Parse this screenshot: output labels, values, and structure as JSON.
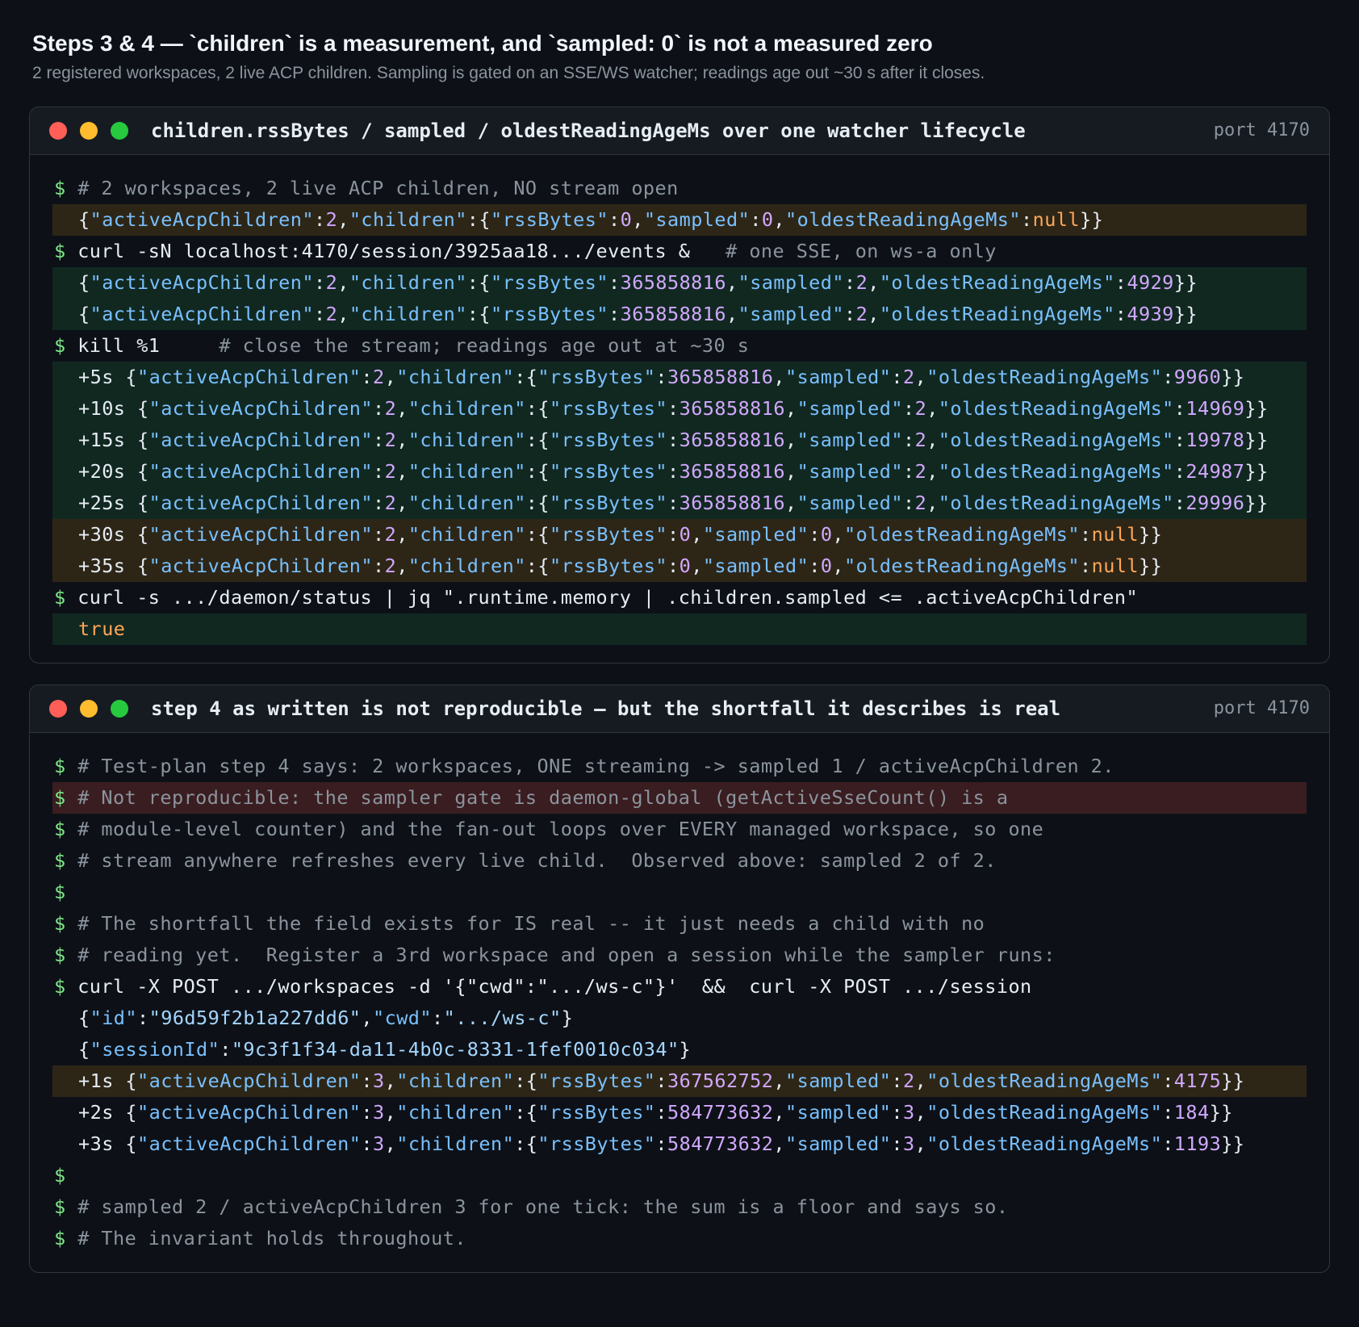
{
  "page": {
    "title": "Steps 3 & 4 — `children` is a measurement, and `sampled: 0` is not a measured zero",
    "subtitle": "2 registered workspaces, 2 live ACP children. Sampling is gated on an SSE/WS watcher; readings age out ~30 s after it closes."
  },
  "terminals": [
    {
      "title": "children.rssBytes / sampled / oldestReadingAgeMs over one watcher lifecycle",
      "port": "port 4170",
      "lines": [
        {
          "kind": "cmd",
          "comment": "# 2 workspaces, 2 live ACP children, NO stream open"
        },
        {
          "kind": "status",
          "hl": "amber",
          "prefix": "",
          "active": "2",
          "rss": "0",
          "sampled": "0",
          "age": "null"
        },
        {
          "kind": "cmd",
          "cmd": "curl -sN localhost:4170/session/3925aa18.../events & ",
          "comment": "  # one SSE, on ws-a only"
        },
        {
          "kind": "status",
          "hl": "green",
          "prefix": "",
          "active": "2",
          "rss": "365858816",
          "sampled": "2",
          "age": "4929"
        },
        {
          "kind": "status",
          "hl": "green",
          "prefix": "",
          "active": "2",
          "rss": "365858816",
          "sampled": "2",
          "age": "4939"
        },
        {
          "kind": "cmd",
          "cmd": "kill %1 ",
          "comment": "    # close the stream; readings age out at ~30 s"
        },
        {
          "kind": "status",
          "hl": "green",
          "prefix": "+5s ",
          "active": "2",
          "rss": "365858816",
          "sampled": "2",
          "age": "9960"
        },
        {
          "kind": "status",
          "hl": "green",
          "prefix": "+10s ",
          "active": "2",
          "rss": "365858816",
          "sampled": "2",
          "age": "14969"
        },
        {
          "kind": "status",
          "hl": "green",
          "prefix": "+15s ",
          "active": "2",
          "rss": "365858816",
          "sampled": "2",
          "age": "19978"
        },
        {
          "kind": "status",
          "hl": "green",
          "prefix": "+20s ",
          "active": "2",
          "rss": "365858816",
          "sampled": "2",
          "age": "24987"
        },
        {
          "kind": "status",
          "hl": "green",
          "prefix": "+25s ",
          "active": "2",
          "rss": "365858816",
          "sampled": "2",
          "age": "29996"
        },
        {
          "kind": "status",
          "hl": "amber",
          "prefix": "+30s ",
          "active": "2",
          "rss": "0",
          "sampled": "0",
          "age": "null"
        },
        {
          "kind": "status",
          "hl": "amber",
          "prefix": "+35s ",
          "active": "2",
          "rss": "0",
          "sampled": "0",
          "age": "null"
        },
        {
          "kind": "cmd",
          "cmd": "curl -s .../daemon/status | jq \".runtime.memory | .children.sampled <= .activeAcpChildren\""
        },
        {
          "kind": "bool",
          "hl": "green",
          "value": "true"
        }
      ]
    },
    {
      "title": "step 4 as written is not reproducible — but the shortfall it describes is real",
      "port": "port 4170",
      "lines": [
        {
          "kind": "cmd",
          "comment": "# Test-plan step 4 says: 2 workspaces, ONE streaming -> sampled 1 / activeAcpChildren 2."
        },
        {
          "kind": "cmd",
          "hl": "red",
          "comment": "# Not reproducible: the sampler gate is daemon-global (getActiveSseCount() is a"
        },
        {
          "kind": "cmd",
          "comment": "# module-level counter) and the fan-out loops over EVERY managed workspace, so one"
        },
        {
          "kind": "cmd",
          "comment": "# stream anywhere refreshes every live child.  Observed above: sampled 2 of 2."
        },
        {
          "kind": "cmd"
        },
        {
          "kind": "cmd",
          "comment": "# The shortfall the field exists for IS real -- it just needs a child with no"
        },
        {
          "kind": "cmd",
          "comment": "# reading yet.  Register a 3rd workspace and open a session while the sampler runs:"
        },
        {
          "kind": "cmd",
          "cmd": "curl -X POST .../workspaces -d '{\"cwd\":\".../ws-c\"}'  &&  curl -X POST .../session"
        },
        {
          "kind": "workspace",
          "id": "96d59f2b1a227dd6",
          "cwd": ".../ws-c"
        },
        {
          "kind": "session",
          "sessionId": "9c3f1f34-da11-4b0c-8331-1fef0010c034"
        },
        {
          "kind": "status",
          "hl": "amber",
          "prefix": "+1s ",
          "active": "3",
          "rss": "367562752",
          "sampled": "2",
          "age": "4175"
        },
        {
          "kind": "status",
          "prefix": "+2s ",
          "active": "3",
          "rss": "584773632",
          "sampled": "3",
          "age": "184"
        },
        {
          "kind": "status",
          "prefix": "+3s ",
          "active": "3",
          "rss": "584773632",
          "sampled": "3",
          "age": "1193"
        },
        {
          "kind": "cmd"
        },
        {
          "kind": "cmd",
          "comment": "# sampled 2 / activeAcpChildren 3 for one tick: the sum is a floor and says so."
        },
        {
          "kind": "cmd",
          "comment": "# The invariant holds throughout."
        }
      ]
    }
  ],
  "syntax": {
    "prompt": "$",
    "keys": {
      "active": "\"activeAcpChildren\"",
      "children": "\"children\"",
      "rss": "\"rssBytes\"",
      "sampled": "\"sampled\"",
      "age": "\"oldestReadingAgeMs\"",
      "id": "\"id\"",
      "cwd": "\"cwd\"",
      "sessionId": "\"sessionId\""
    }
  },
  "colors": {
    "background": "#0d1117",
    "prompt": "#7ee787",
    "comment": "#8b949e",
    "key": "#79c0ff",
    "number": "#d2a8ff",
    "null": "#ffa657",
    "highlight_amber": "#2d2617",
    "highlight_green": "#112821",
    "highlight_red": "#3a1d20"
  }
}
